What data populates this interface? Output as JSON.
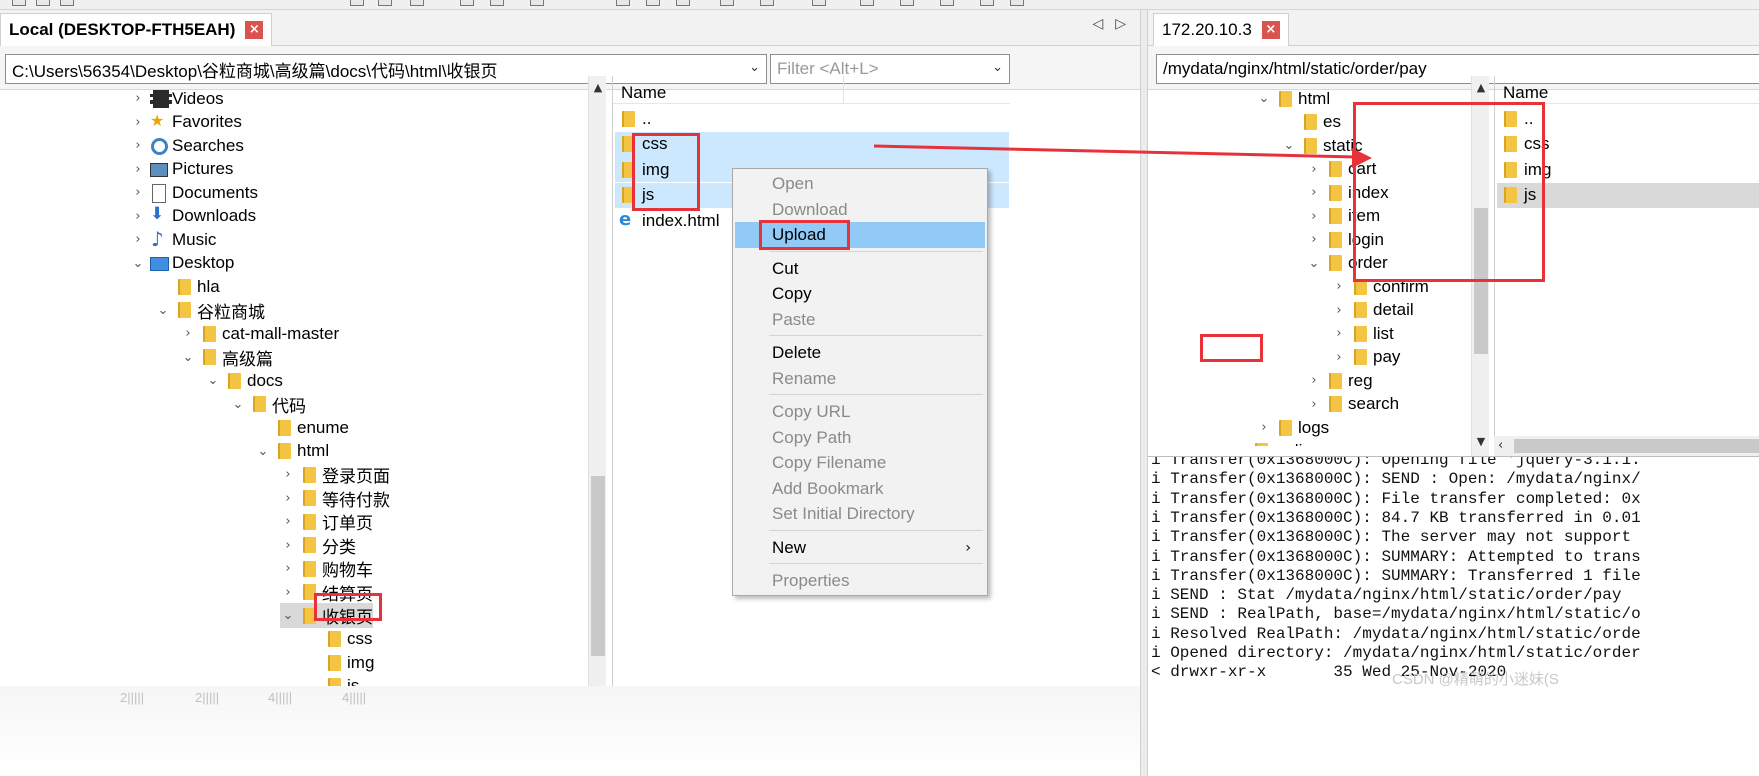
{
  "left": {
    "tab_title": "Local (DESKTOP-FTH5EAH)",
    "path": "C:\\Users\\56354\\Desktop\\谷粒商城\\高级篇\\docs\\代码\\html\\收银页",
    "filter_placeholder": "Filter <Alt+L>",
    "tree": [
      {
        "label": "Videos",
        "icon": "video",
        "chevron": "›"
      },
      {
        "label": "Favorites",
        "icon": "star",
        "chevron": "›"
      },
      {
        "label": "Searches",
        "icon": "search",
        "chevron": "›"
      },
      {
        "label": "Pictures",
        "icon": "pictures",
        "chevron": "›"
      },
      {
        "label": "Documents",
        "icon": "documents",
        "chevron": "›"
      },
      {
        "label": "Downloads",
        "icon": "download",
        "chevron": "›"
      },
      {
        "label": "Music",
        "icon": "music",
        "chevron": "›"
      },
      {
        "label": "Desktop",
        "icon": "desktop",
        "chevron": "⌄"
      },
      {
        "label": "hla",
        "icon": "folder",
        "chevron": ""
      },
      {
        "label": "谷粒商城",
        "icon": "folder",
        "chevron": "⌄"
      },
      {
        "label": "cat-mall-master",
        "icon": "folder",
        "chevron": "›"
      },
      {
        "label": "高级篇",
        "icon": "folder",
        "chevron": "⌄"
      },
      {
        "label": "docs",
        "icon": "folder",
        "chevron": "⌄"
      },
      {
        "label": "代码",
        "icon": "folder",
        "chevron": "⌄"
      },
      {
        "label": "enume",
        "icon": "folder",
        "chevron": ""
      },
      {
        "label": "html",
        "icon": "folder",
        "chevron": "⌄"
      },
      {
        "label": "登录页面",
        "icon": "folder",
        "chevron": "›"
      },
      {
        "label": "等待付款",
        "icon": "folder",
        "chevron": "›"
      },
      {
        "label": "订单页",
        "icon": "folder",
        "chevron": "›"
      },
      {
        "label": "分类",
        "icon": "folder",
        "chevron": "›"
      },
      {
        "label": "购物车",
        "icon": "folder",
        "chevron": "›"
      },
      {
        "label": "结算页",
        "icon": "folder",
        "chevron": "›"
      },
      {
        "label": "收银页",
        "icon": "folder",
        "chevron": "⌄"
      },
      {
        "label": "css",
        "icon": "folder",
        "chevron": ""
      },
      {
        "label": "img",
        "icon": "folder",
        "chevron": ""
      },
      {
        "label": "js",
        "icon": "folder",
        "chevron": ""
      }
    ],
    "list_header": "Name",
    "files": [
      {
        "label": "..",
        "icon": "folder"
      },
      {
        "label": "css",
        "icon": "folder"
      },
      {
        "label": "img",
        "icon": "folder"
      },
      {
        "label": "js",
        "icon": "folder"
      },
      {
        "label": "index.html",
        "icon": "html"
      }
    ]
  },
  "context_menu": [
    {
      "label": "Open",
      "disabled": true
    },
    {
      "label": "Download",
      "disabled": true
    },
    {
      "label": "Upload",
      "disabled": false,
      "highlighted": true
    },
    {
      "label": "Cut",
      "disabled": false
    },
    {
      "label": "Copy",
      "disabled": false
    },
    {
      "label": "Paste",
      "disabled": true
    },
    {
      "label": "Delete",
      "disabled": false
    },
    {
      "label": "Rename",
      "disabled": true
    },
    {
      "label": "Copy URL",
      "disabled": true
    },
    {
      "label": "Copy Path",
      "disabled": true
    },
    {
      "label": "Copy Filename",
      "disabled": true
    },
    {
      "label": "Add Bookmark",
      "disabled": true
    },
    {
      "label": "Set Initial Directory",
      "disabled": true
    },
    {
      "label": "New",
      "disabled": false,
      "submenu": "›"
    },
    {
      "label": "Properties",
      "disabled": true
    }
  ],
  "right": {
    "tab_title": "172.20.10.3",
    "path": "/mydata/nginx/html/static/order/pay",
    "tree": [
      {
        "label": "html",
        "icon": "folder",
        "chevron": "⌄"
      },
      {
        "label": "es",
        "icon": "folder",
        "chevron": ""
      },
      {
        "label": "static",
        "icon": "folder",
        "chevron": "⌄"
      },
      {
        "label": "cart",
        "icon": "folder",
        "chevron": "›"
      },
      {
        "label": "index",
        "icon": "folder",
        "chevron": "›"
      },
      {
        "label": "item",
        "icon": "folder",
        "chevron": "›"
      },
      {
        "label": "login",
        "icon": "folder",
        "chevron": "›"
      },
      {
        "label": "order",
        "icon": "folder",
        "chevron": "⌄"
      },
      {
        "label": "confirm",
        "icon": "folder",
        "chevron": "›"
      },
      {
        "label": "detail",
        "icon": "folder",
        "chevron": "›"
      },
      {
        "label": "list",
        "icon": "folder",
        "chevron": "›"
      },
      {
        "label": "pay",
        "icon": "folder",
        "chevron": "›"
      },
      {
        "label": "reg",
        "icon": "folder",
        "chevron": "›"
      },
      {
        "label": "search",
        "icon": "folder",
        "chevron": "›"
      },
      {
        "label": "logs",
        "icon": "folder",
        "chevron": "›"
      },
      {
        "label": "redis",
        "icon": "folder",
        "chevron": "›"
      }
    ],
    "list_header": "Name",
    "files": [
      {
        "label": "..",
        "icon": "folder"
      },
      {
        "label": "css",
        "icon": "folder"
      },
      {
        "label": "img",
        "icon": "folder"
      },
      {
        "label": "js",
        "icon": "folder"
      }
    ],
    "log": [
      "i Transfer(0x1368000C): Opening file 'jquery-3.1.1.",
      "i Transfer(0x1368000C): SEND : Open: /mydata/nginx/",
      "i Transfer(0x1368000C): File transfer completed: 0x",
      "i Transfer(0x1368000C): 84.7 KB transferred in 0.01",
      "i Transfer(0x1368000C): The server may not support",
      "i Transfer(0x1368000C): SUMMARY: Attempted to trans",
      "i Transfer(0x1368000C): SUMMARY: Transferred 1 file",
      "i SEND : Stat /mydata/nginx/html/static/order/pay",
      "i SEND : RealPath, base=/mydata/nginx/html/static/o",
      "i Resolved RealPath: /mydata/nginx/html/static/orde",
      "i Opened directory: /mydata/nginx/html/static/order",
      "< drwxr-xr-x       35 Wed 25-Nov-2020"
    ]
  },
  "watermark": "CSDN @精萌的小迷妹(S",
  "bottom_labels": [
    "2|||||",
    "2|||||",
    "4|||||",
    "4|||||"
  ],
  "colors": {
    "selection": "#cce8ff",
    "menu_highlight": "#91c9f7",
    "annotation_red": "#e8323a",
    "close_red": "#d9534f",
    "folder": "#f4c542"
  }
}
